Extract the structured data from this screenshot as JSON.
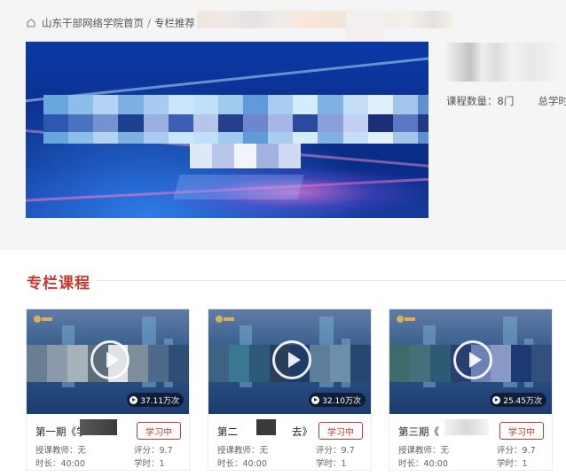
{
  "breadcrumb": {
    "items": [
      "山东干部网络学院首页",
      "专栏推荐"
    ],
    "current": "学"
  },
  "column_info": {
    "course_count": "课程数量：8门",
    "total_hours": "总学时："
  },
  "section": {
    "title": "专栏课程"
  },
  "cards": [
    {
      "title": "第一期《学",
      "views": "37.11万次",
      "status": "学习中",
      "teacher": "授课教师：无",
      "rating": "评分：9.7",
      "duration": "时长：40:00",
      "credits": "学时：1"
    },
    {
      "title": "第二",
      "title_tail": "去》",
      "views": "32.10万次",
      "status": "学习中",
      "teacher": "授课教师：无",
      "rating": "评分：9.7",
      "duration": "时长：40:00",
      "credits": "学时：1"
    },
    {
      "title": "第三期《",
      "views": "25.45万次",
      "status": "学习中",
      "teacher": "授课教师：无",
      "rating": "评分：9.7",
      "duration": "时长：40:00",
      "credits": "学时：1"
    }
  ],
  "colors": {
    "accent": "#c9392f",
    "banner": "#0c2f8f"
  },
  "icons": {
    "breadcrumb_home": "home-icon",
    "play": "play-icon"
  }
}
